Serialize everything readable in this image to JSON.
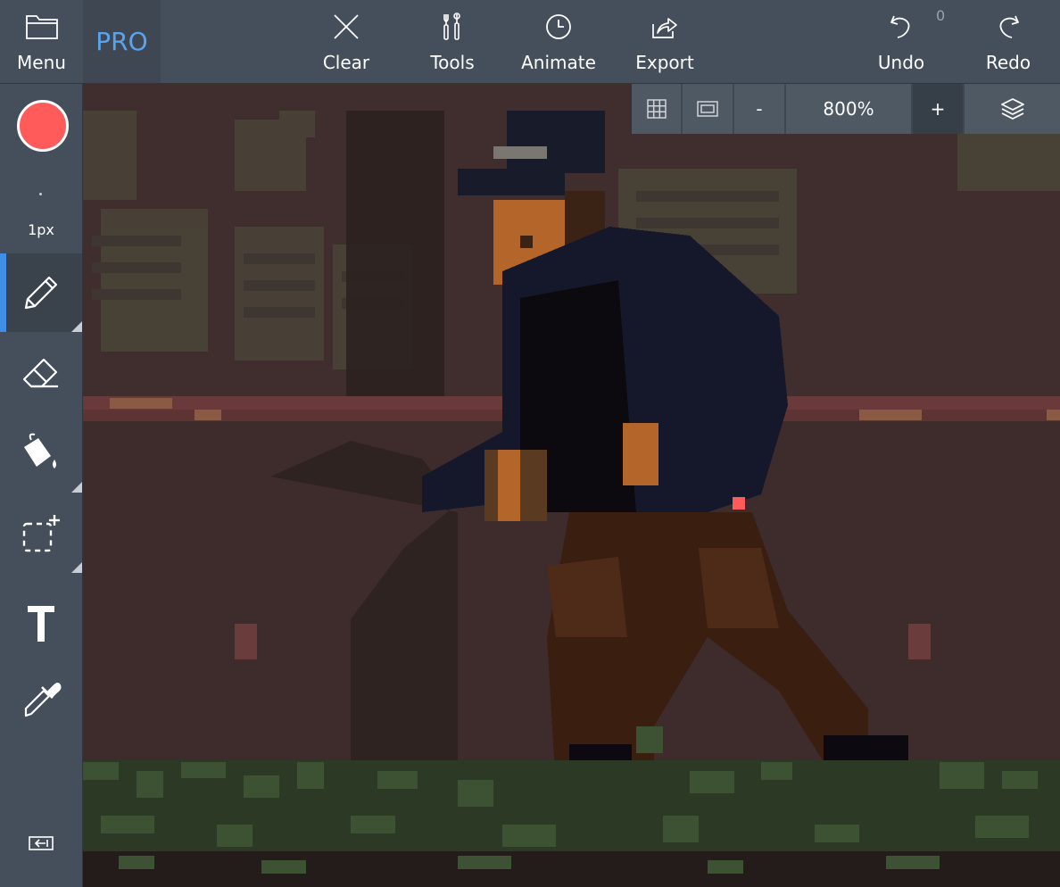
{
  "topbar": {
    "menu_label": "Menu",
    "pro_label": "PRO",
    "clear_label": "Clear",
    "tools_label": "Tools",
    "animate_label": "Animate",
    "export_label": "Export",
    "undo_label": "Undo",
    "undo_count": "0",
    "redo_label": "Redo"
  },
  "leftbar": {
    "current_color": "#ff5b5b",
    "brush_size": "1px",
    "tools": [
      "pencil-icon",
      "eraser-icon",
      "bucket-icon",
      "selection-icon",
      "text-icon",
      "eyedropper-icon"
    ],
    "active_tool": "pencil"
  },
  "viewbar": {
    "zoom_out_label": "-",
    "zoom_level": "800%",
    "zoom_in_label": "+"
  },
  "colors": {
    "accent": "#3d8fe8",
    "pro": "#5aa3ef",
    "toolbar": "#454f5b"
  }
}
